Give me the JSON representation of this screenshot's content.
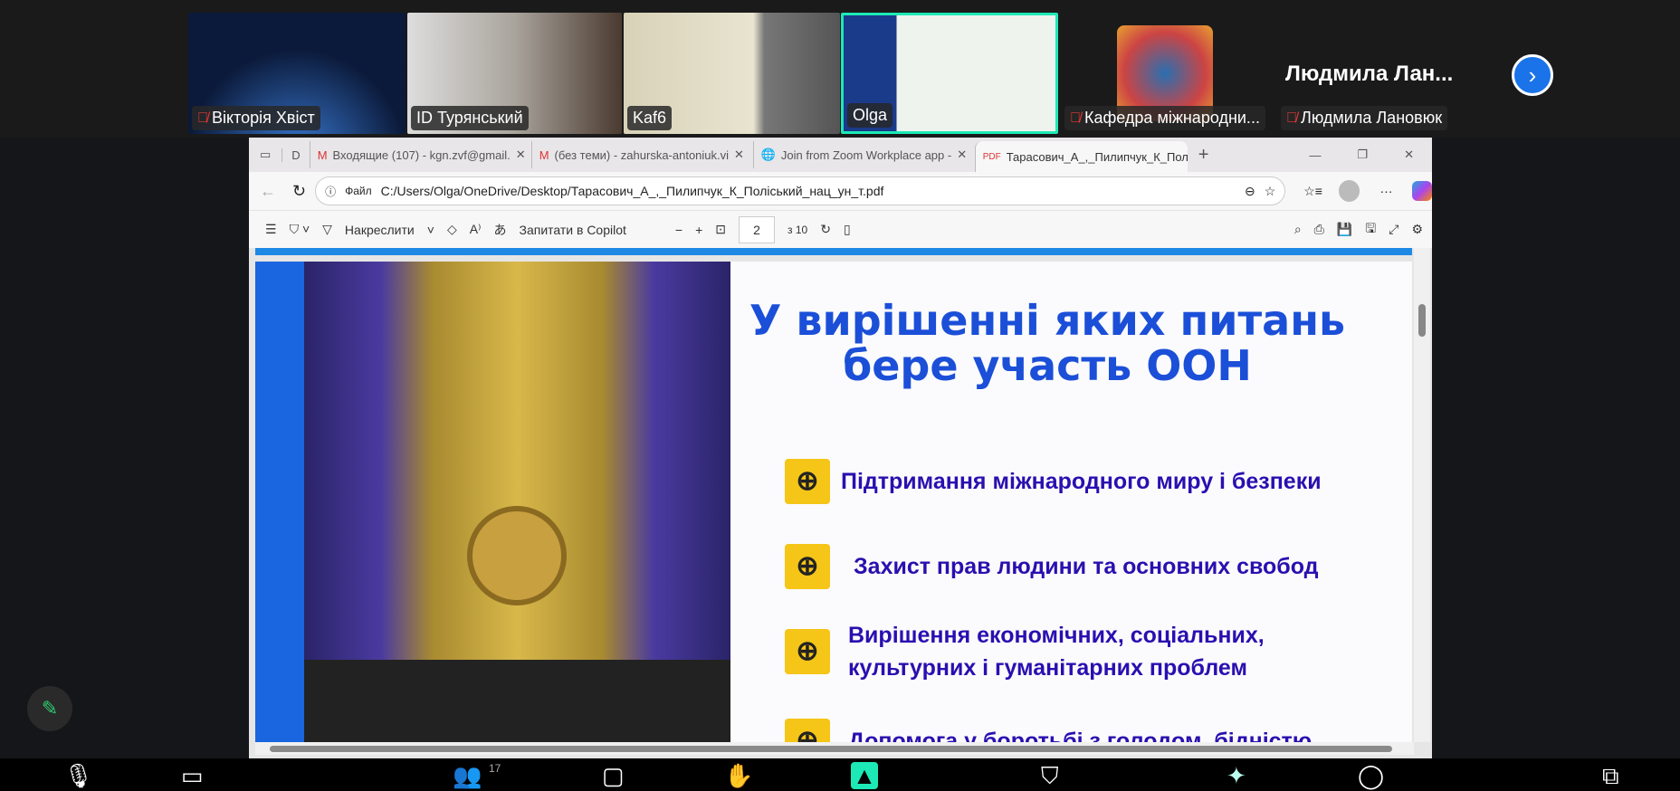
{
  "participants": [
    {
      "name": "Вікторія Хвіст",
      "muted": true
    },
    {
      "name": "ID Турянський",
      "muted": false
    },
    {
      "name": "Kaf6",
      "muted": false
    },
    {
      "name": "Olga",
      "muted": false,
      "active_speaker": true
    },
    {
      "name": "Кафедра міжнародни...",
      "muted": true
    },
    {
      "name": "Людмила Лановюк",
      "muted": true
    }
  ],
  "featured_name": "Людмила Лан...",
  "browser": {
    "tabs": [
      "Входящие (107) - kgn.zvf@gmail.",
      "(без теми) - zahurska-antoniuk.vi",
      "Join from Zoom Workplace app -",
      "Тарасович_А_,_Пилипчук_К_Полі"
    ],
    "address_prefix": "Файл",
    "url": "C:/Users/Olga/OneDrive/Desktop/Тарасович_А_,_Пилипчук_К_Поліський_нац_ун_т.pdf",
    "pdf_toolbar": {
      "draw": "Накреслити",
      "copilot": "Запитати в Copilot",
      "page": "2",
      "of_pages": "з 10"
    }
  },
  "slide": {
    "title": "У вирішенні яких питань бере участь ООН",
    "items": [
      "Підтримання міжнародного миру і безпеки",
      "Захист прав людини та основних свобод",
      "Вирішення економічних, соціальних, культурних і гуманітарних проблем",
      "Допомога у боротьбі з голодом, бідністю,"
    ]
  },
  "meeting_toolbar": {
    "participants_count": "17"
  },
  "colors": {
    "accent": "#1a73e8",
    "slide_title": "#1b4fd8",
    "slide_text": "#2a0fb0",
    "speaker_border": "#1de9b6"
  }
}
